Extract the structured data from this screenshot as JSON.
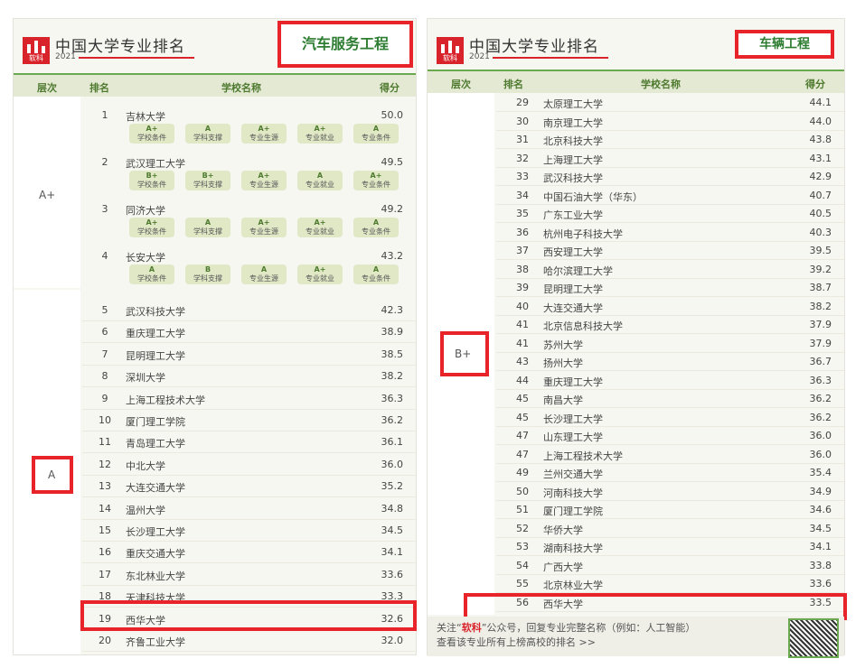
{
  "logo_text": "软科",
  "brand": "中国大学专业排名",
  "year": "2021",
  "left": {
    "major": "汽车服务工程",
    "headers": {
      "level": "层次",
      "rank": "排名",
      "school": "学校名称",
      "score": "得分"
    },
    "levels": [
      "A+",
      "A"
    ],
    "top": [
      {
        "rank": "1",
        "name": "吉林大学",
        "score": "50.0",
        "grades": [
          "A+",
          "A",
          "A+",
          "A+",
          "A"
        ]
      },
      {
        "rank": "2",
        "name": "武汉理工大学",
        "score": "49.5",
        "grades": [
          "B+",
          "B+",
          "A+",
          "A",
          "A+"
        ]
      },
      {
        "rank": "3",
        "name": "同济大学",
        "score": "49.2",
        "grades": [
          "A+",
          "A",
          "A+",
          "A+",
          "A"
        ]
      },
      {
        "rank": "4",
        "name": "长安大学",
        "score": "43.2",
        "grades": [
          "A",
          "B",
          "A",
          "A+",
          "A"
        ]
      }
    ],
    "criteria": [
      "学校条件",
      "学科支撑",
      "专业生源",
      "专业就业",
      "专业条件"
    ],
    "rows": [
      {
        "rank": "5",
        "name": "武汉科技大学",
        "score": "42.3"
      },
      {
        "rank": "6",
        "name": "重庆理工大学",
        "score": "38.9"
      },
      {
        "rank": "7",
        "name": "昆明理工大学",
        "score": "38.5"
      },
      {
        "rank": "8",
        "name": "深圳大学",
        "score": "38.2"
      },
      {
        "rank": "9",
        "name": "上海工程技术大学",
        "score": "36.3"
      },
      {
        "rank": "10",
        "name": "厦门理工学院",
        "score": "36.2"
      },
      {
        "rank": "11",
        "name": "青岛理工大学",
        "score": "36.1"
      },
      {
        "rank": "12",
        "name": "中北大学",
        "score": "36.0"
      },
      {
        "rank": "13",
        "name": "大连交通大学",
        "score": "35.2"
      },
      {
        "rank": "14",
        "name": "温州大学",
        "score": "34.8"
      },
      {
        "rank": "15",
        "name": "长沙理工大学",
        "score": "34.5"
      },
      {
        "rank": "16",
        "name": "重庆交通大学",
        "score": "34.1"
      },
      {
        "rank": "17",
        "name": "东北林业大学",
        "score": "33.6"
      },
      {
        "rank": "18",
        "name": "天津科技大学",
        "score": "33.3"
      },
      {
        "rank": "19",
        "name": "西华大学",
        "score": "32.6"
      },
      {
        "rank": "20",
        "name": "齐鲁工业大学",
        "score": "32.0"
      }
    ]
  },
  "right": {
    "major": "车辆工程",
    "headers": {
      "level": "层次",
      "rank": "排名",
      "school": "学校名称",
      "score": "得分"
    },
    "level": "B+",
    "rows": [
      {
        "rank": "29",
        "name": "太原理工大学",
        "score": "44.1"
      },
      {
        "rank": "30",
        "name": "南京理工大学",
        "score": "44.0"
      },
      {
        "rank": "31",
        "name": "北京科技大学",
        "score": "43.8"
      },
      {
        "rank": "32",
        "name": "上海理工大学",
        "score": "43.1"
      },
      {
        "rank": "33",
        "name": "武汉科技大学",
        "score": "42.9"
      },
      {
        "rank": "34",
        "name": "中国石油大学（华东）",
        "score": "40.7"
      },
      {
        "rank": "35",
        "name": "广东工业大学",
        "score": "40.5"
      },
      {
        "rank": "36",
        "name": "杭州电子科技大学",
        "score": "40.3"
      },
      {
        "rank": "37",
        "name": "西安理工大学",
        "score": "39.5"
      },
      {
        "rank": "38",
        "name": "哈尔滨理工大学",
        "score": "39.2"
      },
      {
        "rank": "39",
        "name": "昆明理工大学",
        "score": "38.7"
      },
      {
        "rank": "40",
        "name": "大连交通大学",
        "score": "38.2"
      },
      {
        "rank": "41",
        "name": "北京信息科技大学",
        "score": "37.9"
      },
      {
        "rank": "41",
        "name": "苏州大学",
        "score": "37.9"
      },
      {
        "rank": "43",
        "name": "扬州大学",
        "score": "36.7"
      },
      {
        "rank": "44",
        "name": "重庆理工大学",
        "score": "36.3"
      },
      {
        "rank": "45",
        "name": "南昌大学",
        "score": "36.2"
      },
      {
        "rank": "45",
        "name": "长沙理工大学",
        "score": "36.2"
      },
      {
        "rank": "47",
        "name": "山东理工大学",
        "score": "36.0"
      },
      {
        "rank": "47",
        "name": "上海工程技术大学",
        "score": "36.0"
      },
      {
        "rank": "49",
        "name": "兰州交通大学",
        "score": "35.4"
      },
      {
        "rank": "50",
        "name": "河南科技大学",
        "score": "34.9"
      },
      {
        "rank": "51",
        "name": "厦门理工学院",
        "score": "34.6"
      },
      {
        "rank": "52",
        "name": "华侨大学",
        "score": "34.5"
      },
      {
        "rank": "53",
        "name": "湖南科技大学",
        "score": "34.1"
      },
      {
        "rank": "54",
        "name": "广西大学",
        "score": "33.8"
      },
      {
        "rank": "55",
        "name": "北京林业大学",
        "score": "33.6"
      },
      {
        "rank": "56",
        "name": "西华大学",
        "score": "33.5"
      }
    ],
    "footer_line1_a": "关注“",
    "footer_line1_em": "软科",
    "footer_line1_b": "”公众号，回复专业完整名称（例如：人工智能）",
    "footer_line2": "查看该专业所有上榜高校的排名 >>"
  }
}
